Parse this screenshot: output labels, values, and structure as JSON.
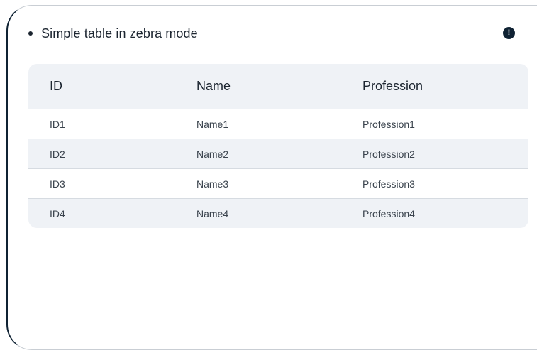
{
  "section": {
    "title": "Simple table in zebra mode",
    "info_icon": "info-icon"
  },
  "table": {
    "columns": [
      "ID",
      "Name",
      "Profession"
    ],
    "rows": [
      [
        "ID1",
        "Name1",
        "Profession1"
      ],
      [
        "ID2",
        "Name2",
        "Profession2"
      ],
      [
        "ID3",
        "Name3",
        "Profession3"
      ],
      [
        "ID4",
        "Name4",
        "Profession4"
      ]
    ]
  },
  "colors": {
    "accent": "#0f2233",
    "zebra": "#eff2f6"
  }
}
